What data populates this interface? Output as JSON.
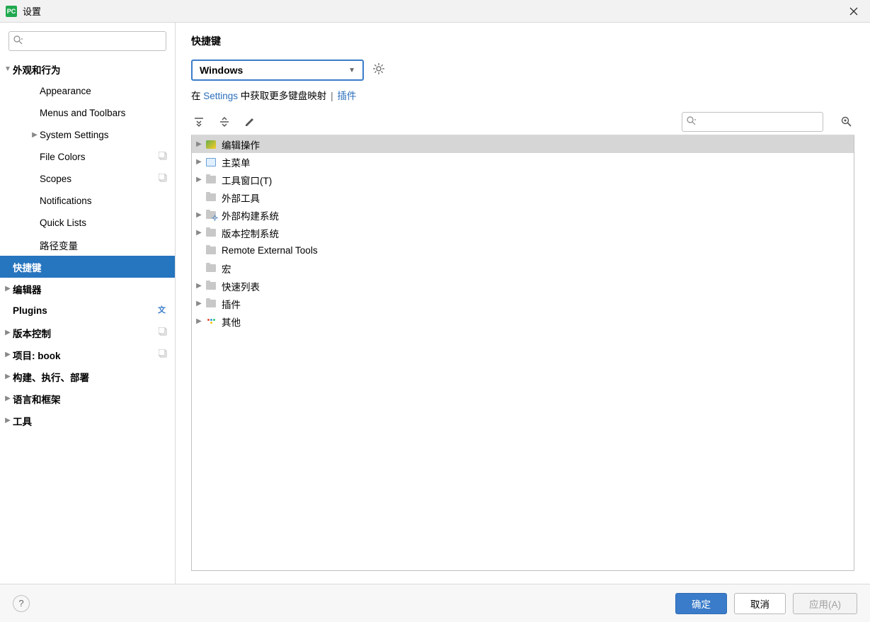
{
  "window": {
    "title": "设置",
    "app_icon_text": "PC"
  },
  "sidebar": {
    "search_placeholder": "",
    "items": [
      {
        "label": "外观和行为",
        "level": 0,
        "expandable": true,
        "expanded": true,
        "bold": true
      },
      {
        "label": "Appearance",
        "level": 1
      },
      {
        "label": "Menus and Toolbars",
        "level": 1
      },
      {
        "label": "System Settings",
        "level": 1,
        "expandable": true,
        "expanded": false
      },
      {
        "label": "File Colors",
        "level": 1,
        "badge": "project"
      },
      {
        "label": "Scopes",
        "level": 1,
        "badge": "project"
      },
      {
        "label": "Notifications",
        "level": 1
      },
      {
        "label": "Quick Lists",
        "level": 1
      },
      {
        "label": "路径变量",
        "level": 1
      },
      {
        "label": "快捷键",
        "level": 0,
        "bold": true,
        "selected": true
      },
      {
        "label": "编辑器",
        "level": 0,
        "expandable": true,
        "expanded": false,
        "bold": true
      },
      {
        "label": "Plugins",
        "level": 0,
        "bold": true,
        "lang_icon": true
      },
      {
        "label": "版本控制",
        "level": 0,
        "expandable": true,
        "expanded": false,
        "bold": true,
        "badge": "project"
      },
      {
        "label": "项目: book",
        "level": 0,
        "expandable": true,
        "expanded": false,
        "bold": true,
        "badge": "project"
      },
      {
        "label": "构建、执行、部署",
        "level": 0,
        "expandable": true,
        "expanded": false,
        "bold": true
      },
      {
        "label": "语言和框架",
        "level": 0,
        "expandable": true,
        "expanded": false,
        "bold": true
      },
      {
        "label": "工具",
        "level": 0,
        "expandable": true,
        "expanded": false,
        "bold": true
      }
    ]
  },
  "content": {
    "title": "快捷键",
    "scheme_selected": "Windows",
    "link_prefix": "在 ",
    "link_settings": "Settings",
    "link_middle": " 中获取更多键盘映射 ",
    "link_plugin": "插件",
    "action_search_placeholder": "",
    "actions": [
      {
        "label": "编辑操作",
        "icon": "special",
        "expandable": true,
        "selected": true
      },
      {
        "label": "主菜单",
        "icon": "menu",
        "expandable": true
      },
      {
        "label": "工具窗口(T)",
        "icon": "folder",
        "expandable": true
      },
      {
        "label": "外部工具",
        "icon": "folder",
        "expandable": false
      },
      {
        "label": "外部构建系统",
        "icon": "gear",
        "expandable": true
      },
      {
        "label": "版本控制系统",
        "icon": "folder",
        "expandable": true
      },
      {
        "label": "Remote External Tools",
        "icon": "folder",
        "expandable": false
      },
      {
        "label": "宏",
        "icon": "folder",
        "expandable": false
      },
      {
        "label": "快速列表",
        "icon": "folder",
        "expandable": true
      },
      {
        "label": "插件",
        "icon": "folder",
        "expandable": true
      },
      {
        "label": "其他",
        "icon": "dots",
        "expandable": true
      }
    ]
  },
  "footer": {
    "ok": "确定",
    "cancel": "取消",
    "apply": "应用(A)"
  }
}
